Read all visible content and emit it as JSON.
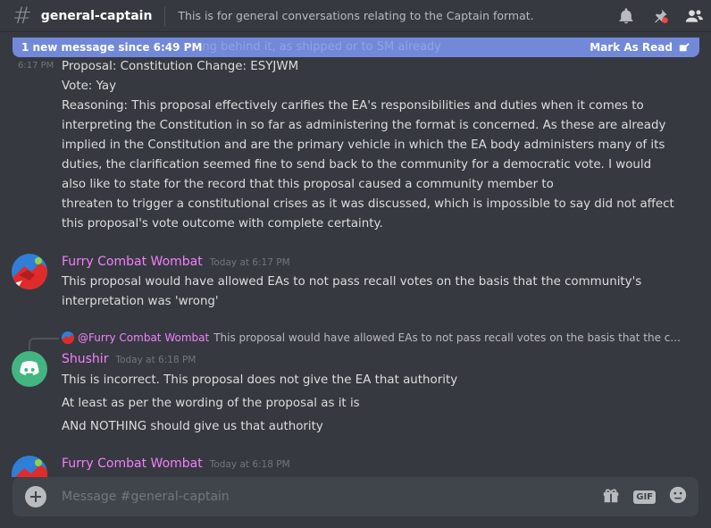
{
  "header": {
    "hash_symbol": "#",
    "channel_name": "general-captain",
    "topic": "This is for general conversations relating to the Captain format."
  },
  "new_messages_bar": {
    "label": "1 new message since 6:49 PM",
    "partial_text_behind": "...ng behind it, as shipped or to SM already",
    "mark_read": "Mark As Read"
  },
  "messages": [
    {
      "timestamp": "6:17 PM",
      "lines": [
        "Proposal: Constitution Change: ESYJWM",
        "Vote: Yay",
        "Reasoning: This proposal effectively carifies the EA's responsibilities and duties when it comes to",
        "interpreting the Constitution in so far as administering the format is concerned. As these are already",
        "implied in the Constitution and are the primary vehicle in which the EA body administers many of its",
        "duties, the clarification seemed fine to send back to the community for a democratic vote. I would",
        "also like to state for the record that this proposal caused a community member to",
        "threaten to trigger a constitutional crises as it was discussed, which is impossible to say did not affect",
        "this proposal's vote outcome with complete certainty."
      ]
    },
    {
      "author": "Furry Combat Wombat",
      "timestamp": "Today at 6:17 PM",
      "lines": [
        "This proposal would have allowed EAs to not pass recall votes on the basis that the community's",
        "interpretation was 'wrong'"
      ]
    },
    {
      "reply_to": {
        "author": "@Furry Combat Wombat",
        "preview": "This proposal would have allowed EAs to not pass recall votes on the basis that the c..."
      },
      "author": "Shushir",
      "timestamp": "Today at 6:18 PM",
      "lines": [
        "This is incorrect. This proposal does not give the EA that authority",
        "At least as per the wording of the proposal as it is",
        "ANd NOTHING should give us that authority"
      ]
    },
    {
      "author": "Furry Combat Wombat",
      "timestamp": "Today at 6:18 PM",
      "lines": []
    }
  ],
  "composer": {
    "placeholder": "Message #general-captain",
    "gif_label": "GIF"
  },
  "icons": {
    "bell": "bell-icon",
    "pin": "pin-icon",
    "members": "members-icon",
    "gift": "gift-icon",
    "emoji": "emoji-icon",
    "add": "add-attachment-icon"
  },
  "colors": {
    "background": "#36393f",
    "accent": "#7289da",
    "username_pink": "#f47fff",
    "composer": "#40444b"
  }
}
